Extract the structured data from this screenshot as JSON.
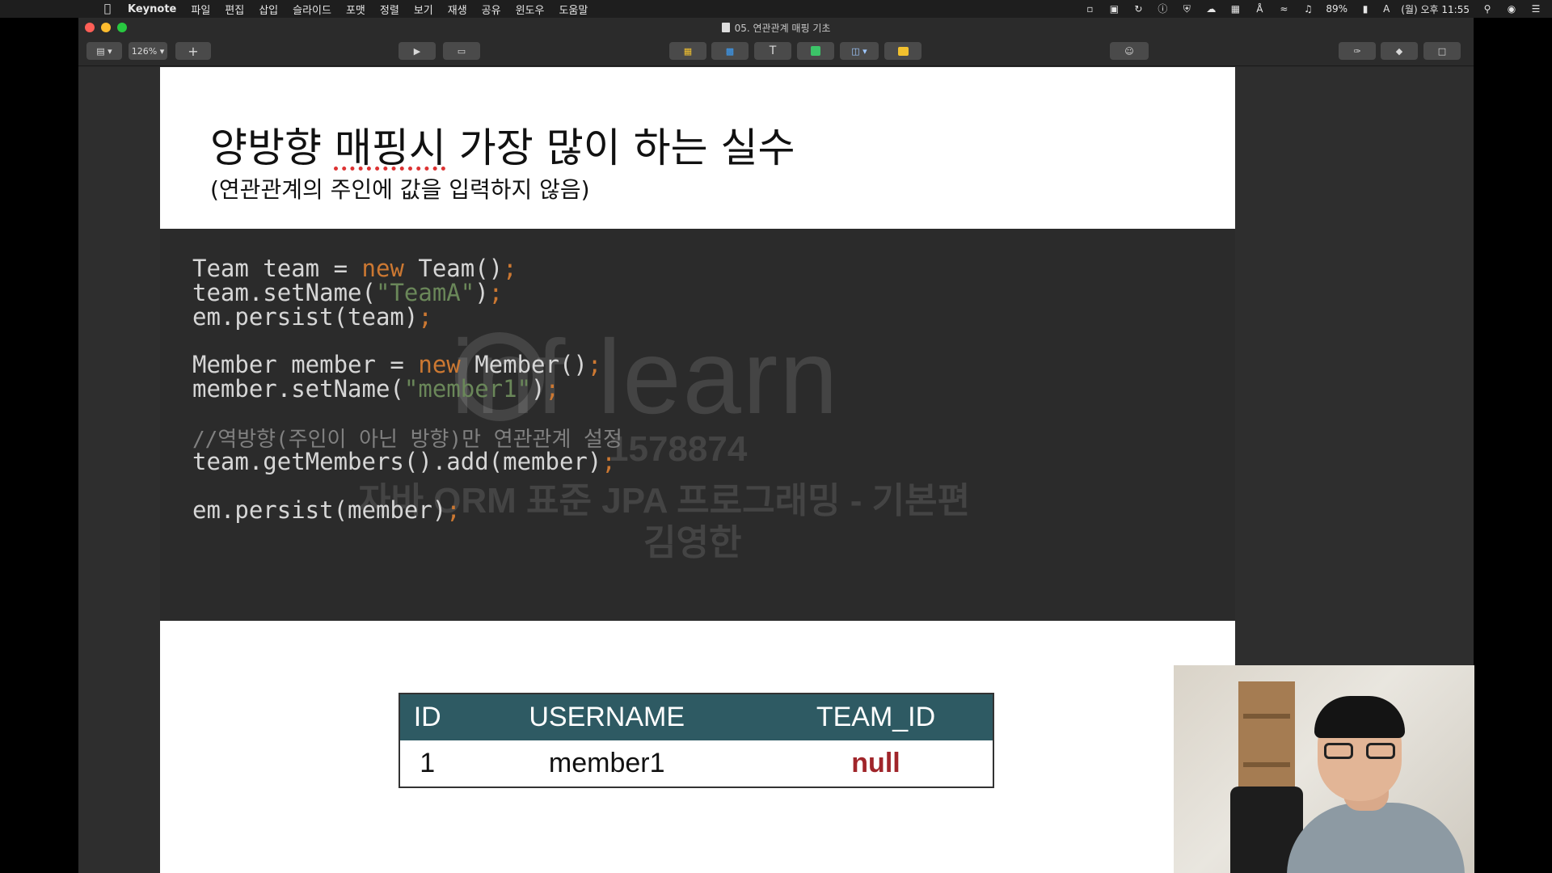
{
  "menubar": {
    "app_name": "Keynote",
    "items": [
      "파일",
      "편집",
      "삽입",
      "슬라이드",
      "포맷",
      "정렬",
      "보기",
      "재생",
      "공유",
      "윈도우",
      "도움말"
    ],
    "battery": "89%",
    "input_source": "A",
    "clock": "(월) 오후 11:55"
  },
  "window": {
    "doc_title": "05. 연관관계 매핑 기초"
  },
  "toolbar": {
    "zoom": "126%",
    "text_glyph": "T"
  },
  "slide": {
    "title_pre": "양방향 ",
    "title_spell": "매핑시",
    "title_post": " 가장 많이 하는 실수",
    "subtitle": "(연관관계의 주인에 값을 입력하지 않음)",
    "code": {
      "l1_a": "Team team = ",
      "l1_kw": "new",
      "l1_b": " Team()",
      "l2_a": "team.setName(",
      "l2_str": "\"TeamA\"",
      "l2_b": ")",
      "l3_a": "em.persist(team)",
      "l4_a": "Member member = ",
      "l4_kw": "new",
      "l4_b": " Member()",
      "l5_a": "member.setName(",
      "l5_str": "\"member1\"",
      "l5_b": ")",
      "l6_comment": "//역방향(주인이 아닌 방향)만 연관관계 설정",
      "l7_a": "team.getMembers().add(member)",
      "l8_a": "em.persist(member)",
      "semicolon": ";"
    },
    "watermark": {
      "logo": "inf learn",
      "user_id": "1578874",
      "course": "자바 ORM 표준 JPA 프로그래밍 - 기본편",
      "author": "김영한"
    },
    "db_table": {
      "headers": [
        "ID",
        "USERNAME",
        "TEAM_ID"
      ],
      "rows": [
        [
          "1",
          "member1",
          "null"
        ]
      ],
      "null_color": "#a0252a",
      "header_color": "#2e5a63"
    }
  }
}
